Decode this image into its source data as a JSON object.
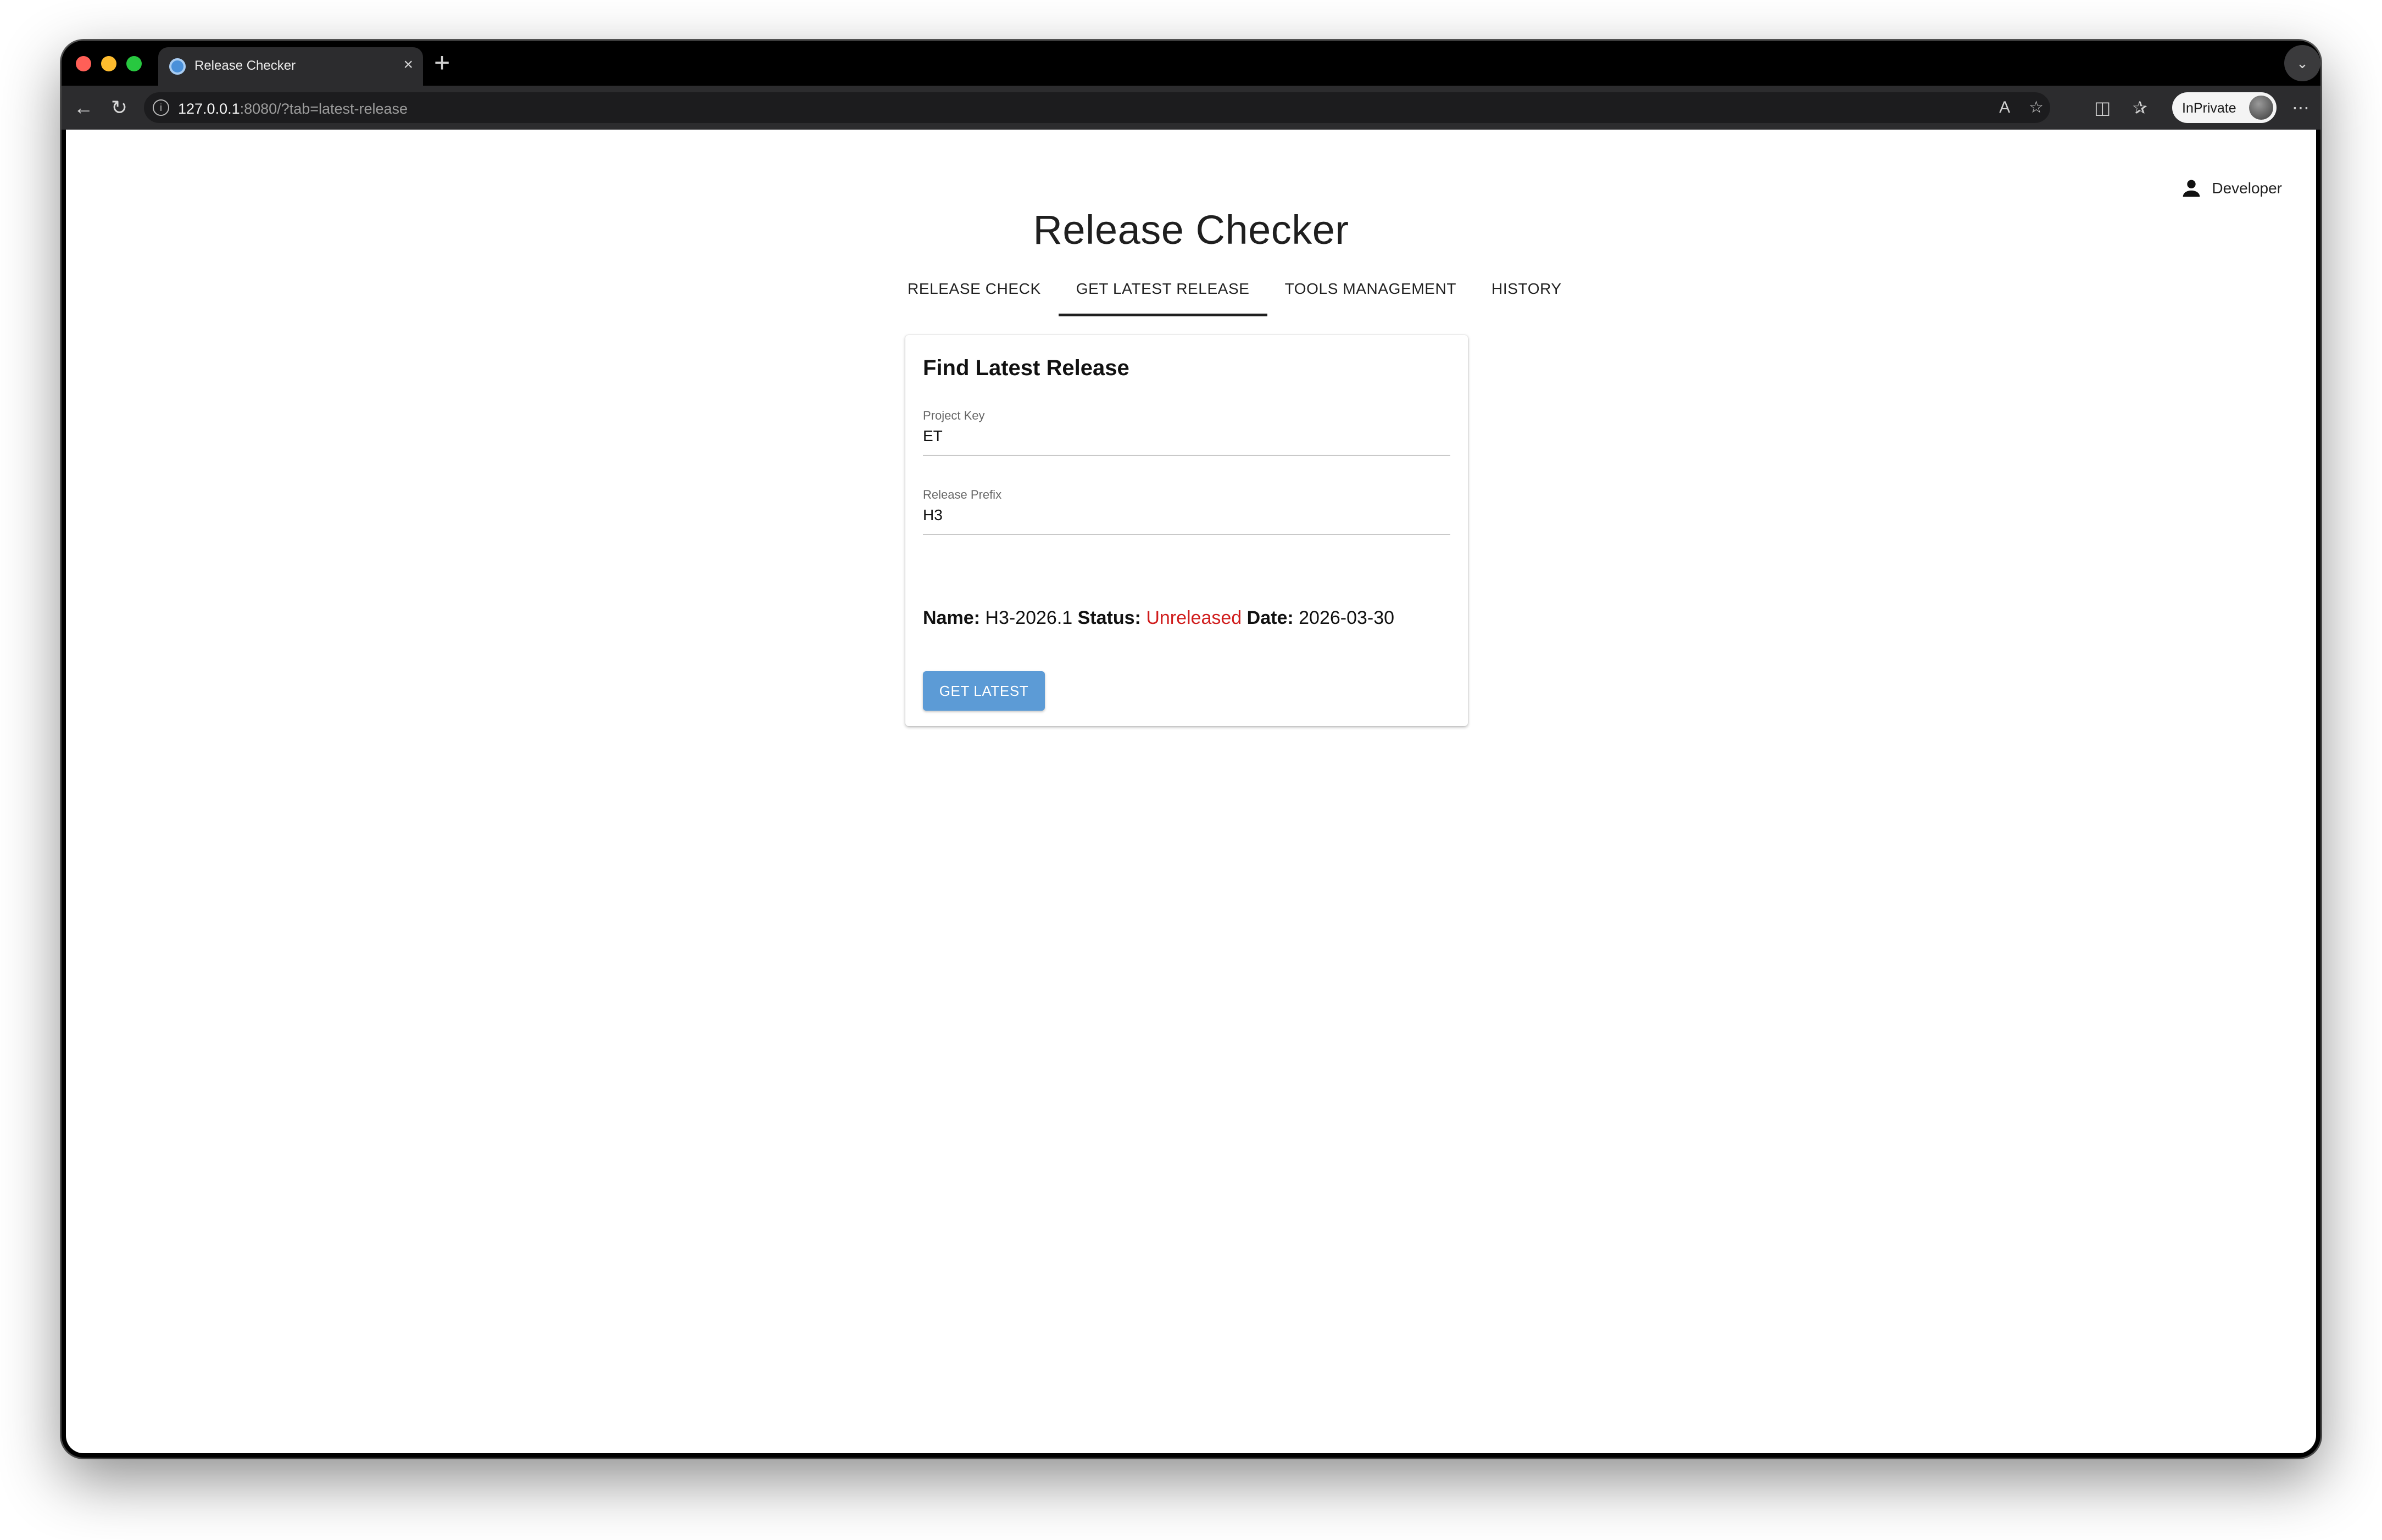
{
  "browser": {
    "tab_title": "Release Checker",
    "tab_close": "×",
    "new_tab": "+",
    "tabs_menu_icon": "chevron-down-icon",
    "address_host": "127.0.0.1",
    "address_rest": ":8080/?tab=latest-release",
    "inprivate_label": "InPrivate",
    "colors": {
      "frame": "#000000",
      "toolbar": "#2c2c2e",
      "close": "#ff5f57",
      "minimize": "#febc2e",
      "maximize": "#28c840"
    }
  },
  "app": {
    "title": "Release Checker",
    "user": {
      "icon": "person-icon",
      "name": "Developer"
    },
    "nav_tabs": [
      {
        "label": "RELEASE CHECK",
        "active": false
      },
      {
        "label": "GET LATEST RELEASE",
        "active": true
      },
      {
        "label": "TOOLS MANAGEMENT",
        "active": false
      },
      {
        "label": "HISTORY",
        "active": false
      }
    ],
    "card": {
      "title": "Find Latest Release",
      "fields": [
        {
          "label": "Project Key",
          "value": "ET"
        },
        {
          "label": "Release Prefix",
          "value": "H3"
        }
      ],
      "result": {
        "name_label": "Name:",
        "name_value": "H3-2026.1",
        "status_label": "Status:",
        "status_value": "Unreleased",
        "date_label": "Date:",
        "date_value": "2026-03-30"
      },
      "button_label": "GET LATEST"
    },
    "colors": {
      "accent_button": "#5c9bd6",
      "status_unreleased": "#d01c1c"
    }
  }
}
